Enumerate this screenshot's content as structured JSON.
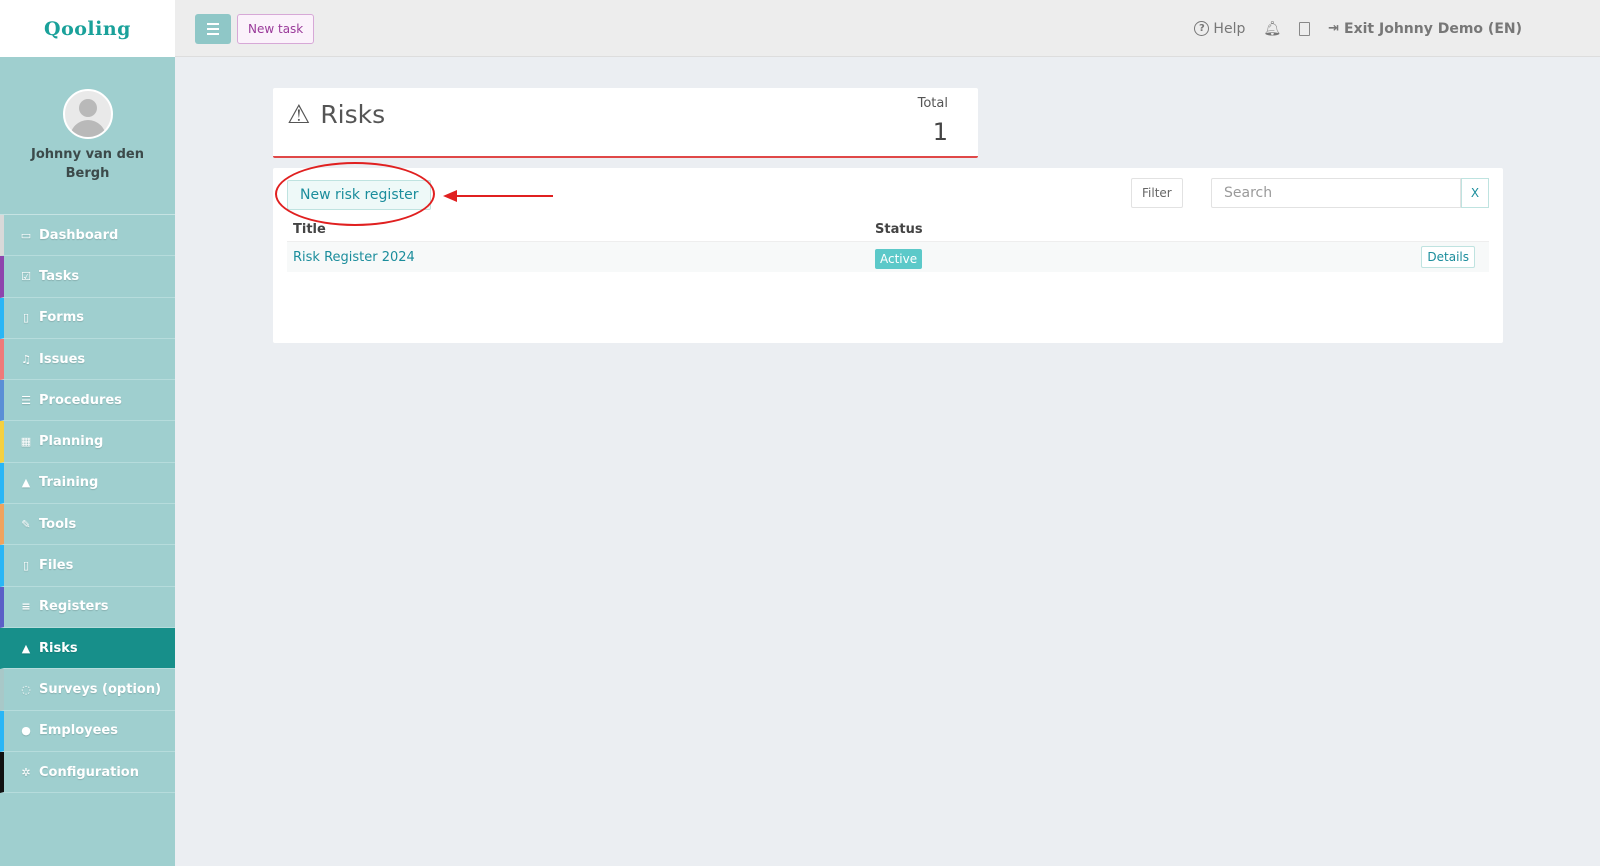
{
  "app": {
    "logo": "Qooling",
    "user_name": "Johnny van den Bergh"
  },
  "topbar": {
    "new_task": "New task",
    "help": "Help",
    "exit": "Exit Johnny Demo (EN)"
  },
  "sidebar": {
    "items": [
      {
        "label": "Dashboard",
        "icon": "monitor-icon",
        "accent": "#d9d9d9"
      },
      {
        "label": "Tasks",
        "icon": "checkbox-icon",
        "accent": "#8e44ad"
      },
      {
        "label": "Forms",
        "icon": "document-icon",
        "accent": "#29b6f6"
      },
      {
        "label": "Issues",
        "icon": "bell-icon",
        "accent": "#ef7a7a"
      },
      {
        "label": "Procedures",
        "icon": "list-icon",
        "accent": "#5b8fd6"
      },
      {
        "label": "Planning",
        "icon": "calendar-icon",
        "accent": "#f4d03f"
      },
      {
        "label": "Training",
        "icon": "graduation-cap-icon",
        "accent": "#29b6f6"
      },
      {
        "label": "Tools",
        "icon": "wrench-icon",
        "accent": "#f0a35e"
      },
      {
        "label": "Files",
        "icon": "pdf-file-icon",
        "accent": "#29b6f6"
      },
      {
        "label": "Registers",
        "icon": "lines-icon",
        "accent": "#5b5fc7"
      },
      {
        "label": "Risks",
        "icon": "warning-icon",
        "accent": "#178f8a",
        "active": true
      },
      {
        "label": "Surveys (option)",
        "icon": "speech-bubble-icon",
        "accent": "#a8c8c8"
      },
      {
        "label": "Employees",
        "icon": "users-icon",
        "accent": "#29b6f6"
      },
      {
        "label": "Configuration",
        "icon": "gear-icon",
        "accent": "#111111"
      }
    ]
  },
  "risks": {
    "title": "Risks",
    "total_label": "Total",
    "total_value": "1"
  },
  "list": {
    "new_button": "New risk register",
    "filter": "Filter",
    "search_placeholder": "Search",
    "clear": "X",
    "columns": {
      "title": "Title",
      "status": "Status"
    },
    "rows": [
      {
        "title": "Risk Register 2024",
        "status": "Active",
        "action": "Details"
      }
    ]
  },
  "colors": {
    "brand": "#1aa19a",
    "sidebar_bg": "#9fcfcf",
    "active_nav": "#178f8a",
    "annotation_red": "#e02020"
  }
}
